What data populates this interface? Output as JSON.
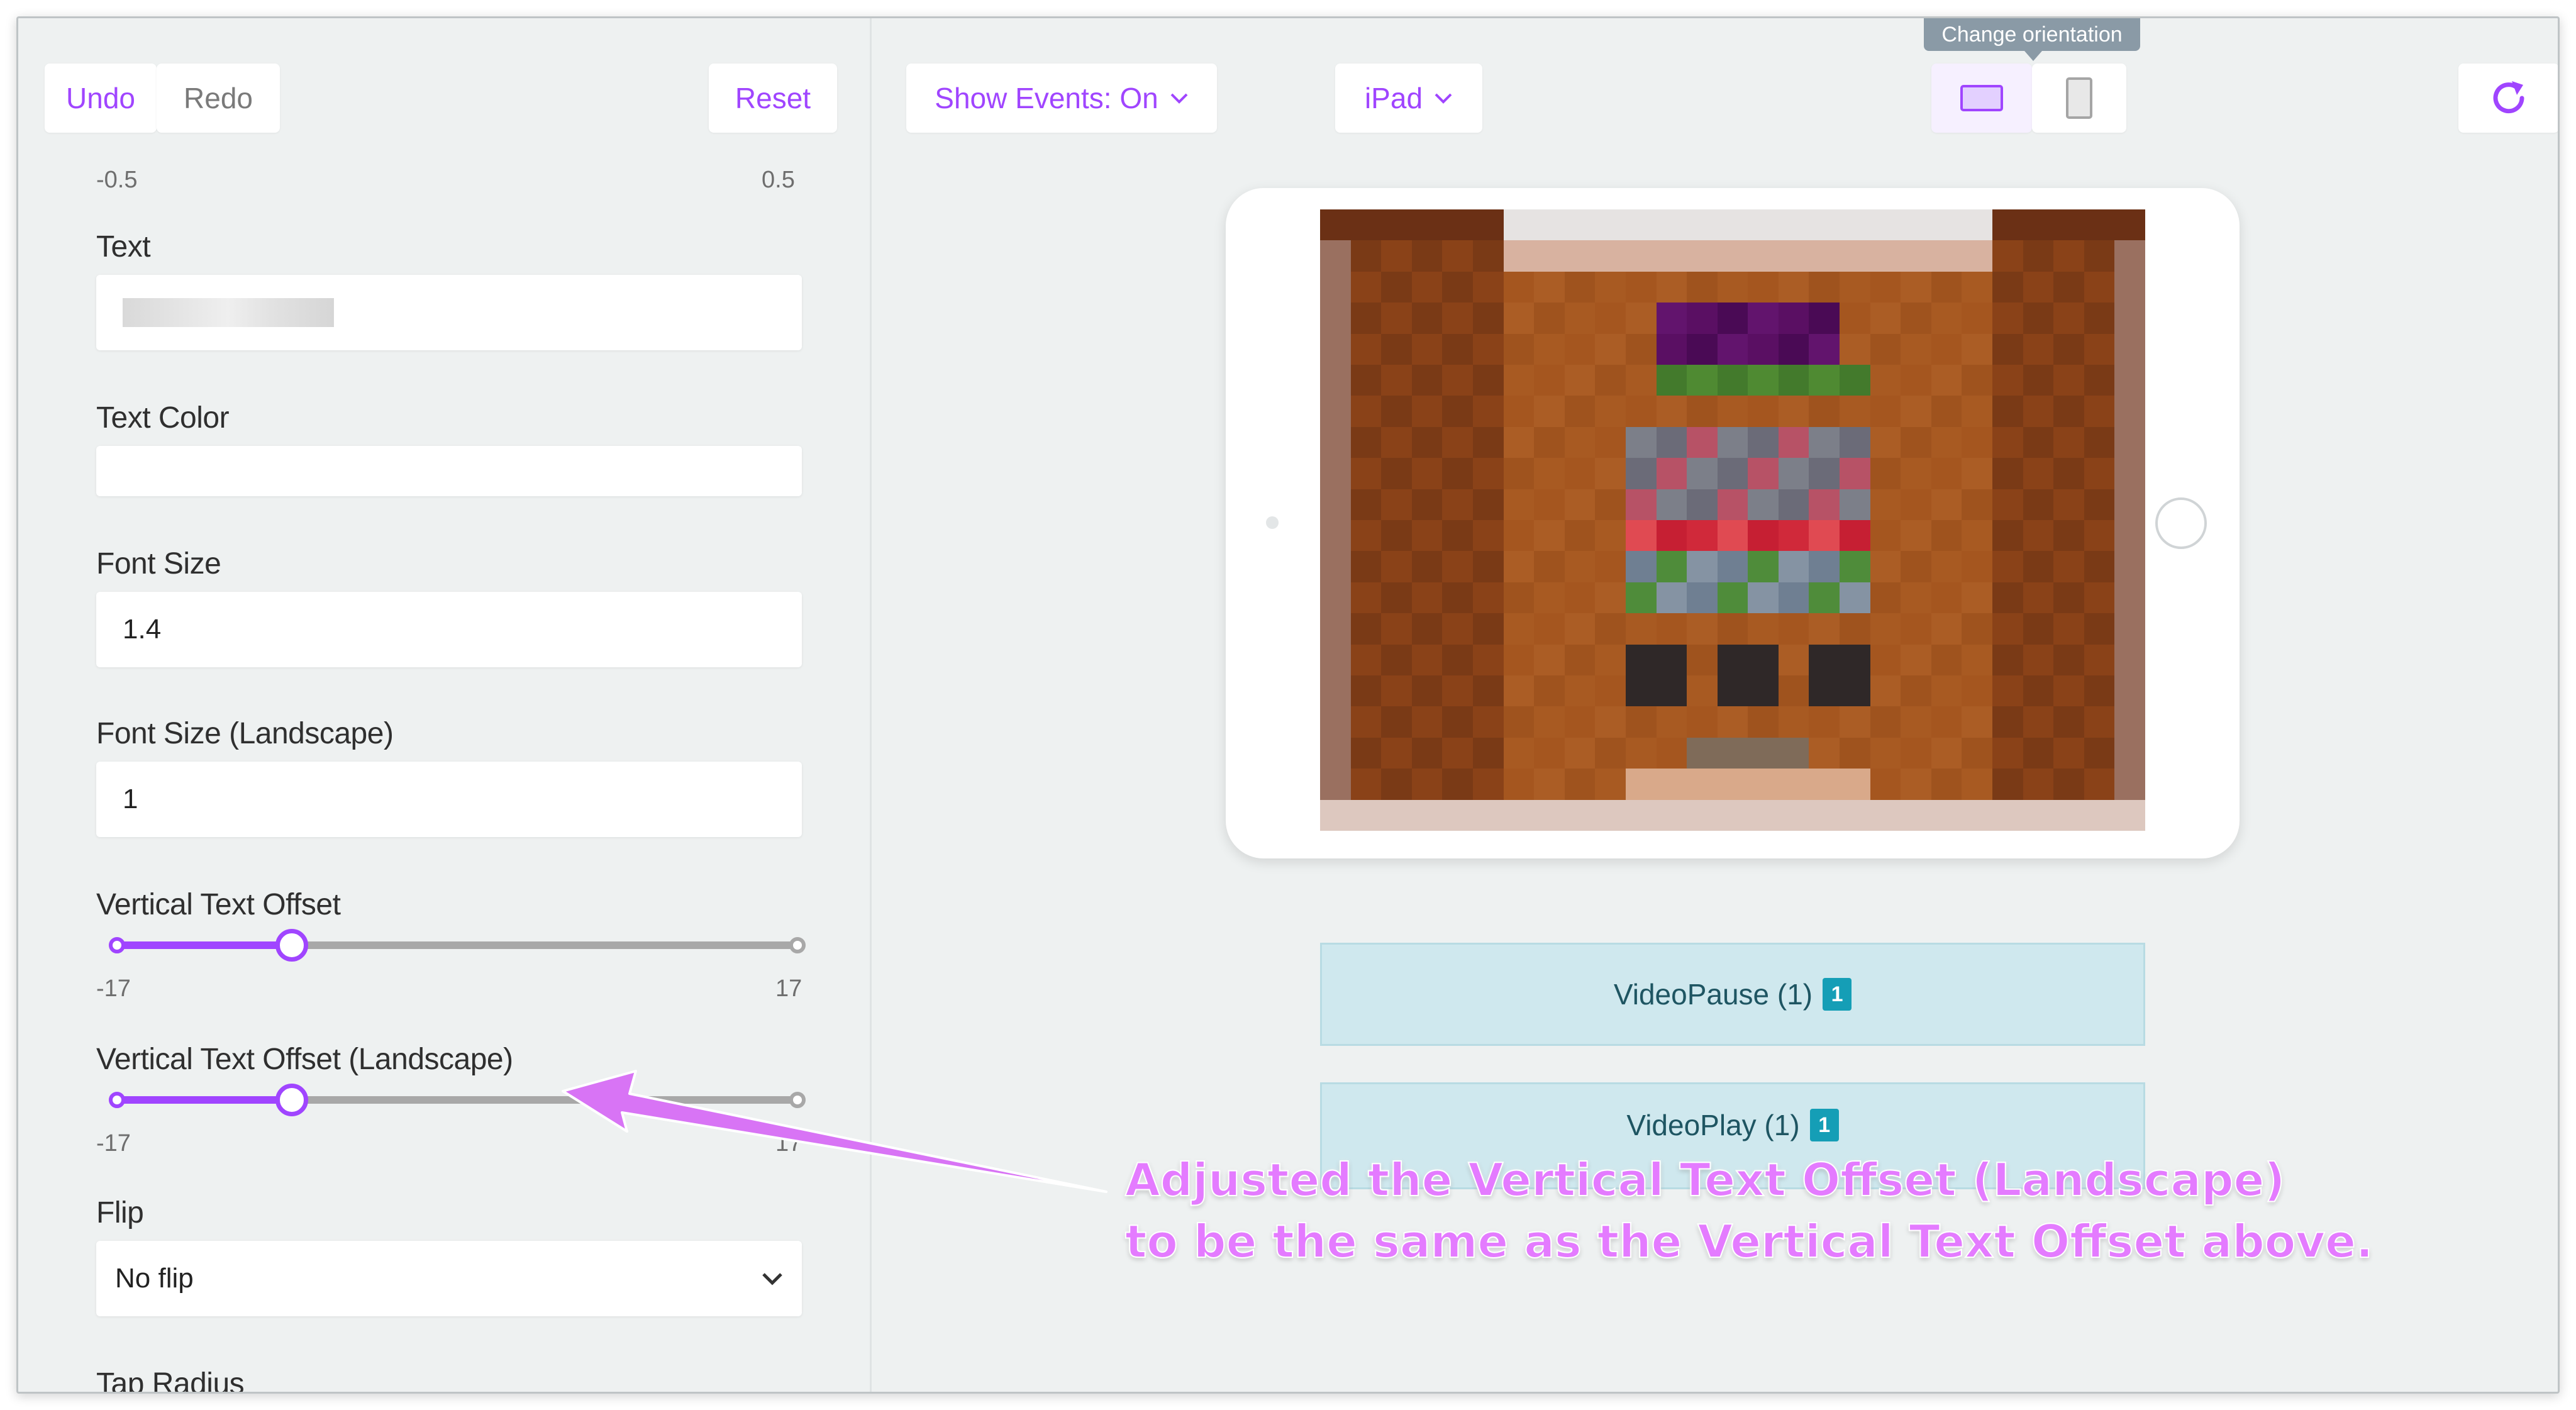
{
  "toolbar": {
    "undo": "Undo",
    "redo": "Redo",
    "reset": "Reset",
    "show_events": "Show Events: On",
    "device": "iPad",
    "orientation_tooltip": "Change orientation"
  },
  "panel": {
    "top_range": {
      "min": "-0.5",
      "max": "0.5"
    },
    "text_label": "Text",
    "text_value_redacted": true,
    "text_color_label": "Text Color",
    "font_size_label": "Font Size",
    "font_size_value": "1.4",
    "font_size_landscape_label": "Font Size (Landscape)",
    "font_size_landscape_value": "1",
    "vertical_offset_label": "Vertical Text Offset",
    "vertical_offset": {
      "min": "-17",
      "max": "17",
      "value_fraction": 0.26
    },
    "vertical_offset_landscape_label": "Vertical Text Offset (Landscape)",
    "vertical_offset_landscape": {
      "min": "-17",
      "max": "17",
      "value_fraction": 0.26
    },
    "flip_label": "Flip",
    "flip_value": "No flip",
    "tap_radius_label": "Tap Radius"
  },
  "events": [
    {
      "label": "VideoPause (1)",
      "badge": "1"
    },
    {
      "label": "VideoPlay (1)",
      "badge": "1"
    }
  ],
  "annotation": {
    "line1": "Adjusted the Vertical Text Offset (Landscape)",
    "line2": "to be the same as the Vertical Text Offset above."
  },
  "colors": {
    "accent": "#a045ff",
    "annotation": "#e47bff",
    "event_bg": "#cfe8ee",
    "badge": "#159eb6"
  },
  "icons": {
    "refresh": "refresh-icon",
    "landscape": "landscape-icon",
    "portrait": "portrait-icon",
    "dropdown": "chevron-down-icon"
  }
}
